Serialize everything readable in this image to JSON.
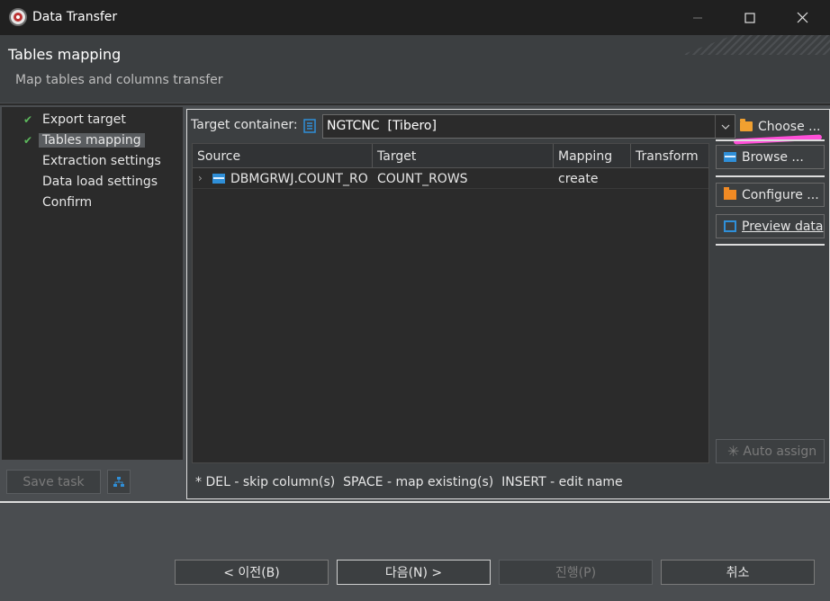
{
  "window": {
    "title": "Data Transfer",
    "minimize_icon": "minimize-icon",
    "maximize_icon": "maximize-icon",
    "close_icon": "close-icon"
  },
  "header": {
    "title": "Tables mapping",
    "description": "Map tables and columns transfer"
  },
  "nav": {
    "items": [
      {
        "label": "Export target",
        "checked": true,
        "selected": false
      },
      {
        "label": "Tables mapping",
        "checked": true,
        "selected": true
      },
      {
        "label": "Extraction settings",
        "checked": false,
        "selected": false
      },
      {
        "label": "Data load settings",
        "checked": false,
        "selected": false
      },
      {
        "label": "Confirm",
        "checked": false,
        "selected": false
      }
    ],
    "save_task_label": "Save task"
  },
  "target_container": {
    "label": "Target container:",
    "value": "NGTCNC  [Tibero]",
    "choose_label": "Choose ..."
  },
  "grid": {
    "columns": [
      "Source",
      "Target",
      "Mapping",
      "Transform"
    ],
    "rows": [
      {
        "source": "DBMGRWJ.COUNT_RO",
        "target": "COUNT_ROWS",
        "mapping": "create",
        "transform": ""
      }
    ]
  },
  "side_buttons": {
    "browse": "Browse ...",
    "configure": "Configure ...",
    "preview": "Preview data",
    "auto_assign": "Auto assign"
  },
  "hint": "* DEL - skip column(s)  SPACE - map existing(s)  INSERT - edit name",
  "footer": {
    "back": "< 이전(B)",
    "next": "다음(N) >",
    "proceed": "진행(P)",
    "cancel": "취소"
  },
  "colors": {
    "accent_blue": "#2f8fd8",
    "folder_orange": "#f0a030",
    "check_green": "#5cb85c",
    "highlight_pink": "#ff4fd8"
  }
}
